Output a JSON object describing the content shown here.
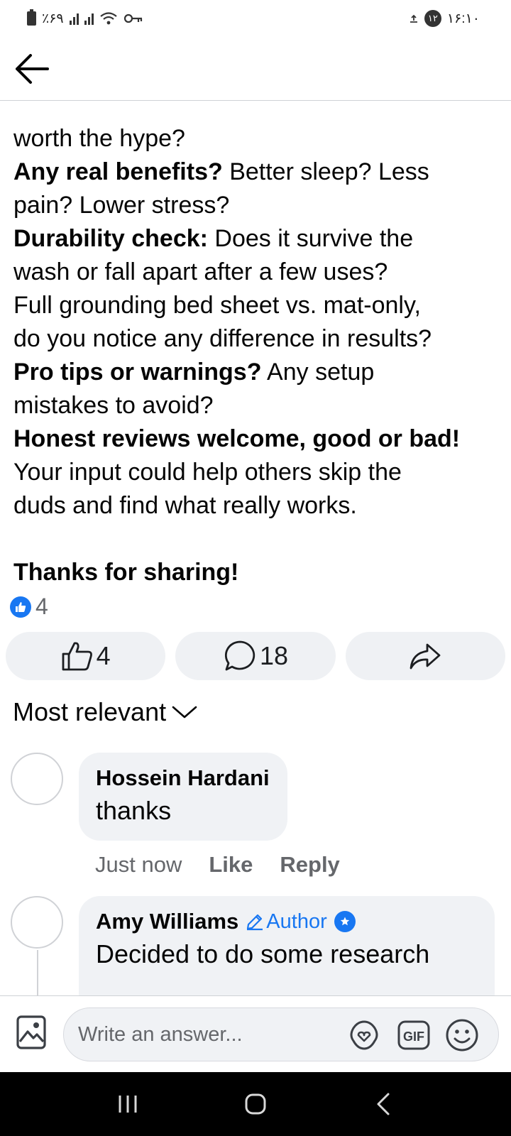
{
  "status_bar": {
    "battery": "٪۶۹",
    "time": "۱۶:۱۰",
    "notification_count": "۱۲"
  },
  "post": {
    "clipped_line": "worth the hype?",
    "lines": [
      {
        "bold": "",
        "text": "worth the hype?"
      },
      {
        "bold": "Any real benefits?",
        "text": " Better sleep? Less"
      },
      {
        "bold": "",
        "text": "pain? Lower stress?"
      },
      {
        "bold": "Durability check:",
        "text": " Does it survive the"
      },
      {
        "bold": "",
        "text": "wash or fall apart after a few uses?"
      },
      {
        "bold": "",
        "text": "Full grounding bed sheet vs. mat-only,"
      },
      {
        "bold": "",
        "text": "do you notice any difference in results?"
      },
      {
        "bold": "Pro tips or warnings?",
        "text": " Any setup"
      },
      {
        "bold": "",
        "text": "mistakes to avoid?"
      },
      {
        "bold": "Honest reviews welcome, good or bad!",
        "text": ""
      },
      {
        "bold": "",
        "text": "Your input could help others skip the"
      },
      {
        "bold": "",
        "text": "duds and find what really works."
      },
      {
        "bold": "",
        "text": ""
      },
      {
        "bold": "Thanks for sharing!",
        "text": ""
      }
    ]
  },
  "reactions": {
    "count": "4"
  },
  "actions": {
    "like_count": "4",
    "comment_count": "18"
  },
  "comments_sort": {
    "label": "Most relevant"
  },
  "comments": [
    {
      "author": "Hossein Hardani",
      "text": "thanks",
      "time": "Just now",
      "like_label": "Like",
      "reply_label": "Reply"
    },
    {
      "author": "Amy Williams",
      "badge": "Author",
      "text": "Decided to do some research"
    }
  ],
  "composer": {
    "placeholder": "Write an answer..."
  },
  "colors": {
    "accent": "#1877f2",
    "bubble": "#f0f2f5",
    "muted_text": "#65676b"
  }
}
